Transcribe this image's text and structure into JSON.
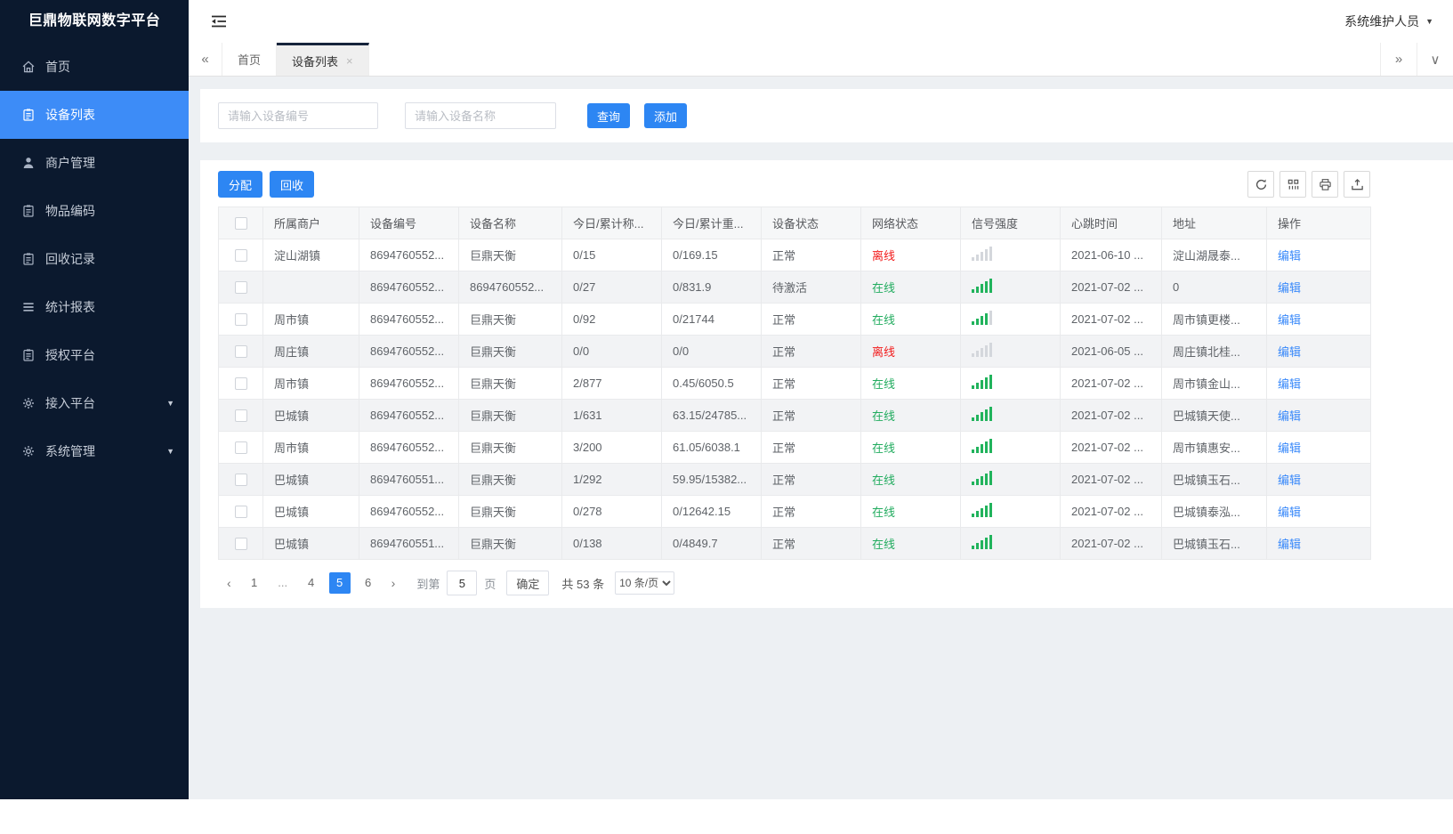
{
  "app": {
    "title": "巨鼎物联网数字平台",
    "user_name": "系统维护人员"
  },
  "glyphs": {
    "caret_down": "▼",
    "tabs_scroll_left": "«",
    "tabs_scroll_right": "»",
    "tabs_menu": "∨",
    "tab_close": "×",
    "page_prev": "‹",
    "page_next": "›"
  },
  "sidebar": {
    "items": [
      {
        "key": "home",
        "icon": "home-icon",
        "label": "首页",
        "active": false,
        "expandable": false
      },
      {
        "key": "device-list",
        "icon": "document-icon",
        "label": "设备列表",
        "active": true,
        "expandable": false
      },
      {
        "key": "merchant-management",
        "icon": "user-icon",
        "label": "商户管理",
        "active": false,
        "expandable": false
      },
      {
        "key": "item-code",
        "icon": "document-icon",
        "label": "物品编码",
        "active": false,
        "expandable": false
      },
      {
        "key": "recycle-records",
        "icon": "document-icon",
        "label": "回收记录",
        "active": false,
        "expandable": false
      },
      {
        "key": "statistics-report",
        "icon": "menu-icon",
        "label": "统计报表",
        "active": false,
        "expandable": false
      },
      {
        "key": "authorization-platform",
        "icon": "document-icon",
        "label": "授权平台",
        "active": false,
        "expandable": false
      },
      {
        "key": "access-platform",
        "icon": "gear-icon",
        "label": "接入平台",
        "active": false,
        "expandable": true
      },
      {
        "key": "system-management",
        "icon": "gear-icon",
        "label": "系统管理",
        "active": false,
        "expandable": true
      }
    ]
  },
  "tabbar": {
    "tabs": [
      {
        "key": "home",
        "label": "首页",
        "active": false,
        "closable": false
      },
      {
        "key": "device-list",
        "label": "设备列表",
        "active": true,
        "closable": true
      }
    ]
  },
  "search": {
    "inputs": [
      {
        "placeholder": "请输入设备编号"
      },
      {
        "placeholder": "请输入设备名称"
      }
    ],
    "query_label": "查询",
    "add_label": "添加"
  },
  "actions": {
    "assign_label": "分配",
    "recycle_label": "回收"
  },
  "toolbar": {
    "icons": [
      "refresh-icon",
      "columns-icon",
      "print-icon",
      "export-icon"
    ]
  },
  "table": {
    "columns": [
      "所属商户",
      "设备编号",
      "设备名称",
      "今日/累计称...",
      "今日/累计重...",
      "设备状态",
      "网络状态",
      "信号强度",
      "心跳时间",
      "地址",
      "操作"
    ],
    "edit_label": "编辑",
    "rows": [
      {
        "merchant": "淀山湖镇",
        "device_no": "8694760552...",
        "device_name": "巨鼎天衡",
        "today_count": "0/15",
        "today_weight": "0/169.15",
        "status": "正常",
        "network": "离线",
        "online": false,
        "signal": 0,
        "heartbeat": "2021-06-10 ...",
        "address": "淀山湖晟泰..."
      },
      {
        "merchant": "",
        "device_no": "8694760552...",
        "device_name": "8694760552...",
        "today_count": "0/27",
        "today_weight": "0/831.9",
        "status": "待激活",
        "network": "在线",
        "online": true,
        "signal": 5,
        "heartbeat": "2021-07-02 ...",
        "address": "0"
      },
      {
        "merchant": "周市镇",
        "device_no": "8694760552...",
        "device_name": "巨鼎天衡",
        "today_count": "0/92",
        "today_weight": "0/21744",
        "status": "正常",
        "network": "在线",
        "online": true,
        "signal": 4,
        "heartbeat": "2021-07-02 ...",
        "address": "周市镇更楼..."
      },
      {
        "merchant": "周庄镇",
        "device_no": "8694760552...",
        "device_name": "巨鼎天衡",
        "today_count": "0/0",
        "today_weight": "0/0",
        "status": "正常",
        "network": "离线",
        "online": false,
        "signal": 0,
        "heartbeat": "2021-06-05 ...",
        "address": "周庄镇北桂..."
      },
      {
        "merchant": "周市镇",
        "device_no": "8694760552...",
        "device_name": "巨鼎天衡",
        "today_count": "2/877",
        "today_weight": "0.45/6050.5",
        "status": "正常",
        "network": "在线",
        "online": true,
        "signal": 5,
        "heartbeat": "2021-07-02 ...",
        "address": "周市镇金山..."
      },
      {
        "merchant": "巴城镇",
        "device_no": "8694760552...",
        "device_name": "巨鼎天衡",
        "today_count": "1/631",
        "today_weight": "63.15/24785...",
        "status": "正常",
        "network": "在线",
        "online": true,
        "signal": 5,
        "heartbeat": "2021-07-02 ...",
        "address": "巴城镇天使..."
      },
      {
        "merchant": "周市镇",
        "device_no": "8694760552...",
        "device_name": "巨鼎天衡",
        "today_count": "3/200",
        "today_weight": "61.05/6038.1",
        "status": "正常",
        "network": "在线",
        "online": true,
        "signal": 5,
        "heartbeat": "2021-07-02 ...",
        "address": "周市镇惠安..."
      },
      {
        "merchant": "巴城镇",
        "device_no": "8694760551...",
        "device_name": "巨鼎天衡",
        "today_count": "1/292",
        "today_weight": "59.95/15382...",
        "status": "正常",
        "network": "在线",
        "online": true,
        "signal": 5,
        "heartbeat": "2021-07-02 ...",
        "address": "巴城镇玉石..."
      },
      {
        "merchant": "巴城镇",
        "device_no": "8694760552...",
        "device_name": "巨鼎天衡",
        "today_count": "0/278",
        "today_weight": "0/12642.15",
        "status": "正常",
        "network": "在线",
        "online": true,
        "signal": 5,
        "heartbeat": "2021-07-02 ...",
        "address": "巴城镇泰泓..."
      },
      {
        "merchant": "巴城镇",
        "device_no": "8694760551...",
        "device_name": "巨鼎天衡",
        "today_count": "0/138",
        "today_weight": "0/4849.7",
        "status": "正常",
        "network": "在线",
        "online": true,
        "signal": 5,
        "heartbeat": "2021-07-02 ...",
        "address": "巴城镇玉石..."
      }
    ]
  },
  "pagination": {
    "pages": [
      "1",
      "...",
      "4",
      "5",
      "6"
    ],
    "active_page": "5",
    "goto_label": "到第",
    "goto_value": "5",
    "page_unit": "页",
    "confirm_label": "确定",
    "total_label": "共 53 条",
    "page_size_label": "10 条/页"
  },
  "colors": {
    "accent": "#2d86f3",
    "sidebar_bg": "#0b192e",
    "active_item": "#3d8cf7",
    "online_green": "#22ac5f",
    "offline_red": "#f21c1c",
    "signal_green": "#21b35c",
    "link_blue": "#3989fa"
  }
}
